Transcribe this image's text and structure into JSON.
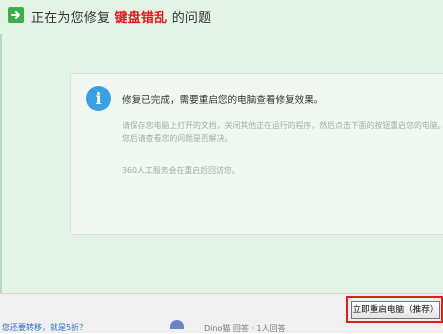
{
  "header": {
    "title_prefix": "正在为您修复",
    "title_highlight": "键盘错乱",
    "title_suffix": "的问题",
    "highlight_color": "#e4161d"
  },
  "message": {
    "icon": "info-icon",
    "icon_glyph": "i",
    "main": "修复已完成，需要重启您的电脑查看修复效果。",
    "detail_lines": [
      "请保存您电脑上打开的文档，关闭其他正在运行的程序，然后点击下面的按钮重启您的电脑。",
      "您后请查看您的问题是否解决。"
    ],
    "note": "360人工服务会在重启后回访您。"
  },
  "footer": {
    "left_link": "您还要转移，就是5折？",
    "background_text": "Dino猫 回答 · 1人回答",
    "restart_button": "立即重启电脑（推荐）",
    "highlight_color": "#dc1f1f"
  }
}
